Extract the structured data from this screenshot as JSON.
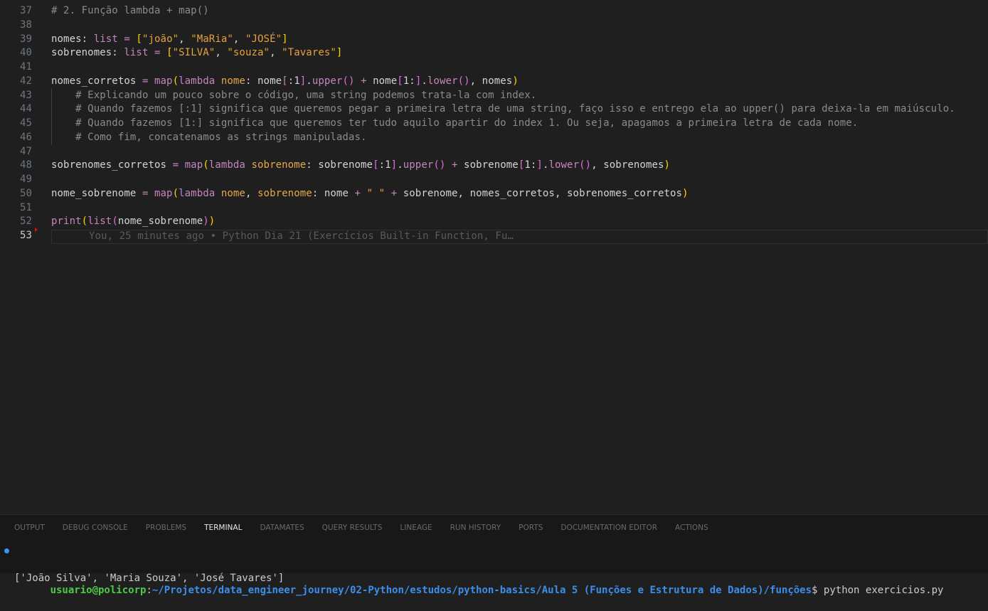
{
  "editor": {
    "lines": [
      {
        "n": "37",
        "tokens": [
          [
            "cm",
            "# 2. Função lambda + map()"
          ]
        ]
      },
      {
        "n": "38",
        "tokens": []
      },
      {
        "n": "39",
        "tokens": [
          [
            "var",
            "nomes: "
          ],
          [
            "ty",
            "list"
          ],
          [
            "var",
            " "
          ],
          [
            "op",
            "="
          ],
          [
            "var",
            " "
          ],
          [
            "b1",
            "["
          ],
          [
            "st",
            "\"joão\""
          ],
          [
            "var",
            ", "
          ],
          [
            "st",
            "\"MaRia\""
          ],
          [
            "var",
            ", "
          ],
          [
            "st",
            "\"JOSÉ\""
          ],
          [
            "b1",
            "]"
          ]
        ]
      },
      {
        "n": "40",
        "tokens": [
          [
            "var",
            "sobrenomes: "
          ],
          [
            "ty",
            "list"
          ],
          [
            "var",
            " "
          ],
          [
            "op",
            "="
          ],
          [
            "var",
            " "
          ],
          [
            "b1",
            "["
          ],
          [
            "st",
            "\"SILVA\""
          ],
          [
            "var",
            ", "
          ],
          [
            "st",
            "\"souza\""
          ],
          [
            "var",
            ", "
          ],
          [
            "st",
            "\"Tavares\""
          ],
          [
            "b1",
            "]"
          ]
        ]
      },
      {
        "n": "41",
        "tokens": []
      },
      {
        "n": "42",
        "tokens": [
          [
            "var",
            "nomes_corretos "
          ],
          [
            "op",
            "="
          ],
          [
            "var",
            " "
          ],
          [
            "fn",
            "map"
          ],
          [
            "b1",
            "("
          ],
          [
            "kw",
            "lambda"
          ],
          [
            "var",
            " "
          ],
          [
            "pr",
            "nome"
          ],
          [
            "var",
            ": nome"
          ],
          [
            "b2",
            "["
          ],
          [
            "var",
            ":1"
          ],
          [
            "b2",
            "]"
          ],
          [
            "var",
            "."
          ],
          [
            "fn",
            "upper"
          ],
          [
            "b2",
            "()"
          ],
          [
            "var",
            " "
          ],
          [
            "op",
            "+"
          ],
          [
            "var",
            " nome"
          ],
          [
            "b2",
            "["
          ],
          [
            "var",
            "1:"
          ],
          [
            "b2",
            "]"
          ],
          [
            "var",
            "."
          ],
          [
            "fn",
            "lower"
          ],
          [
            "b2",
            "()"
          ],
          [
            "var",
            ", nomes"
          ],
          [
            "b1",
            ")"
          ]
        ]
      },
      {
        "n": "43",
        "tokens": [
          [
            "var",
            "    "
          ],
          [
            "cm",
            "# Explicando um pouco sobre o código, uma string podemos trata-la com index."
          ]
        ]
      },
      {
        "n": "44",
        "tokens": [
          [
            "var",
            "    "
          ],
          [
            "cm",
            "# Quando fazemos [:1] significa que queremos pegar a primeira letra de uma string, faço isso e entrego ela ao upper() para deixa-la em maiúsculo."
          ]
        ]
      },
      {
        "n": "45",
        "tokens": [
          [
            "var",
            "    "
          ],
          [
            "cm",
            "# Quando fazemos [1:] significa que queremos ter tudo aquilo apartir do index 1. Ou seja, apagamos a primeira letra de cada nome."
          ]
        ]
      },
      {
        "n": "46",
        "tokens": [
          [
            "var",
            "    "
          ],
          [
            "cm",
            "# Como fim, concatenamos as strings manipuladas."
          ]
        ]
      },
      {
        "n": "47",
        "tokens": []
      },
      {
        "n": "48",
        "tokens": [
          [
            "var",
            "sobrenomes_corretos "
          ],
          [
            "op",
            "="
          ],
          [
            "var",
            " "
          ],
          [
            "fn",
            "map"
          ],
          [
            "b1",
            "("
          ],
          [
            "kw",
            "lambda"
          ],
          [
            "var",
            " "
          ],
          [
            "pr",
            "sobrenome"
          ],
          [
            "var",
            ": sobrenome"
          ],
          [
            "b2",
            "["
          ],
          [
            "var",
            ":1"
          ],
          [
            "b2",
            "]"
          ],
          [
            "var",
            "."
          ],
          [
            "fn",
            "upper"
          ],
          [
            "b2",
            "()"
          ],
          [
            "var",
            " "
          ],
          [
            "op",
            "+"
          ],
          [
            "var",
            " sobrenome"
          ],
          [
            "b2",
            "["
          ],
          [
            "var",
            "1:"
          ],
          [
            "b2",
            "]"
          ],
          [
            "var",
            "."
          ],
          [
            "fn",
            "lower"
          ],
          [
            "b2",
            "()"
          ],
          [
            "var",
            ", sobrenomes"
          ],
          [
            "b1",
            ")"
          ]
        ]
      },
      {
        "n": "49",
        "tokens": []
      },
      {
        "n": "50",
        "tokens": [
          [
            "var",
            "nome_sobrenome "
          ],
          [
            "op",
            "="
          ],
          [
            "var",
            " "
          ],
          [
            "fn",
            "map"
          ],
          [
            "b1",
            "("
          ],
          [
            "kw",
            "lambda"
          ],
          [
            "var",
            " "
          ],
          [
            "pr",
            "nome"
          ],
          [
            "var",
            ", "
          ],
          [
            "pr",
            "sobrenome"
          ],
          [
            "var",
            ": nome "
          ],
          [
            "op",
            "+"
          ],
          [
            "var",
            " "
          ],
          [
            "st",
            "\" \""
          ],
          [
            "var",
            " "
          ],
          [
            "op",
            "+"
          ],
          [
            "var",
            " sobrenome, nomes_corretos, sobrenomes_corretos"
          ],
          [
            "b1",
            ")"
          ]
        ]
      },
      {
        "n": "51",
        "tokens": []
      },
      {
        "n": "52",
        "tokens": [
          [
            "fn",
            "print"
          ],
          [
            "b1",
            "("
          ],
          [
            "fn",
            "list"
          ],
          [
            "b2",
            "("
          ],
          [
            "var",
            "nome_sobrenome"
          ],
          [
            "b2",
            ")"
          ],
          [
            "b1",
            ")"
          ]
        ]
      },
      {
        "n": "53",
        "tokens": []
      }
    ],
    "blame": "You, 25 minutes ago • Python Dia 21 (Exercícios Built-in Function, Fu…"
  },
  "panel": {
    "tabs": [
      "OUTPUT",
      "DEBUG CONSOLE",
      "PROBLEMS",
      "TERMINAL",
      "DATAMATES",
      "QUERY RESULTS",
      "LINEAGE",
      "RUN HISTORY",
      "PORTS",
      "DOCUMENTATION EDITOR",
      "ACTIONS"
    ],
    "active_tab": "TERMINAL",
    "terminal": {
      "user": "usuario@policorp",
      "sep": ":",
      "path": "~/Projetos/data_engineer_journey/02-Python/estudos/python-basics/Aula 5 (Funções e Estrutura de Dados)/funções",
      "prompt_tail": "$ python exercicios.py",
      "output": "['João Silva', 'Maria Souza', 'José Tavares']"
    }
  },
  "colors": {
    "background": "#1f1f1f",
    "comment": "#8b8b8b",
    "keyword": "#c586c0",
    "string": "#e6a23c",
    "param": "#e5a84b",
    "bracket1": "#ffd700",
    "bracket2": "#da70d6",
    "terminal_user": "#4ec94a",
    "terminal_path": "#3b8eea",
    "terminal_dot": "#3794ff"
  }
}
